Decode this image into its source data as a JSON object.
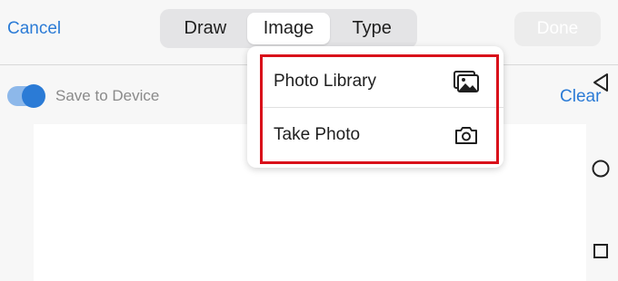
{
  "header": {
    "cancel_label": "Cancel",
    "tabs": [
      {
        "label": "Draw"
      },
      {
        "label": "Image"
      },
      {
        "label": "Type"
      }
    ],
    "selected_tab": "Image",
    "done_label": "Done"
  },
  "options": {
    "save_to_device_label": "Save to Device",
    "save_to_device_on": true,
    "clear_label": "Clear"
  },
  "dropdown": {
    "items": [
      {
        "label": "Photo Library",
        "icon": "photo-library-icon"
      },
      {
        "label": "Take Photo",
        "icon": "camera-icon"
      }
    ]
  },
  "colors": {
    "accent": "#2b7bd6",
    "highlight": "#d9101a"
  }
}
